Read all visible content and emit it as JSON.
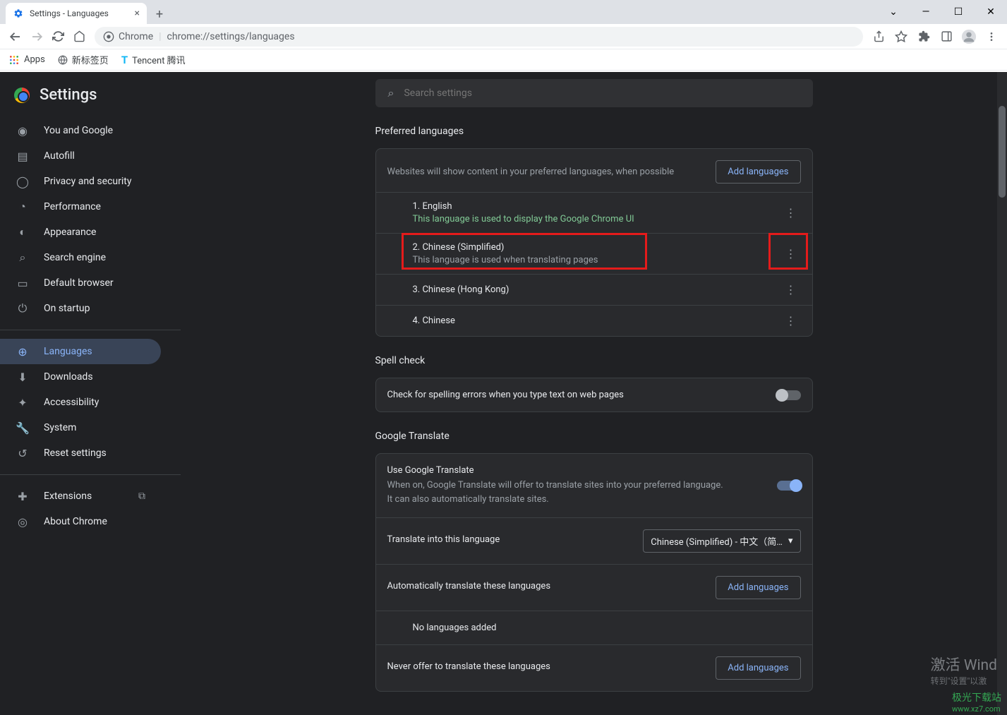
{
  "window": {
    "tab_title": "Settings - Languages",
    "url_label": "Chrome",
    "url_path": "chrome://settings/languages"
  },
  "bookmarks": {
    "apps": "Apps",
    "newtab": "新标签页",
    "tencent": "Tencent 腾讯"
  },
  "sidebar": {
    "title": "Settings",
    "items": [
      {
        "label": "You and Google"
      },
      {
        "label": "Autofill"
      },
      {
        "label": "Privacy and security"
      },
      {
        "label": "Performance"
      },
      {
        "label": "Appearance"
      },
      {
        "label": "Search engine"
      },
      {
        "label": "Default browser"
      },
      {
        "label": "On startup"
      },
      {
        "label": "Languages"
      },
      {
        "label": "Downloads"
      },
      {
        "label": "Accessibility"
      },
      {
        "label": "System"
      },
      {
        "label": "Reset settings"
      },
      {
        "label": "Extensions"
      },
      {
        "label": "About Chrome"
      }
    ]
  },
  "search": {
    "placeholder": "Search settings"
  },
  "preferred": {
    "title": "Preferred languages",
    "hint": "Websites will show content in your preferred languages, when possible",
    "add": "Add languages",
    "langs": [
      {
        "name": "1. English",
        "sub": "This language is used to display the Google Chrome UI",
        "green": true
      },
      {
        "name": "2. Chinese (Simplified)",
        "sub": "This language is used when translating pages",
        "green": false
      },
      {
        "name": "3. Chinese (Hong Kong)",
        "sub": "",
        "green": false
      },
      {
        "name": "4. Chinese",
        "sub": "",
        "green": false
      }
    ]
  },
  "spell": {
    "title": "Spell check",
    "label": "Check for spelling errors when you type text on web pages"
  },
  "translate": {
    "title": "Google Translate",
    "use_title": "Use Google Translate",
    "use_desc": "When on, Google Translate will offer to translate sites into your preferred language. It can also automatically translate sites.",
    "translate_into": "Translate into this language",
    "dropdown": "Chinese (Simplified) - 中文（简…",
    "auto_title": "Automatically translate these languages",
    "add": "Add languages",
    "no_langs": "No languages added",
    "never_title": "Never offer to translate these languages"
  },
  "watermark": {
    "line1": "激活 Wind",
    "line2": "转到\"设置\"以激",
    "logo1": "极光下载站",
    "logo2": "www.xz7.com"
  }
}
